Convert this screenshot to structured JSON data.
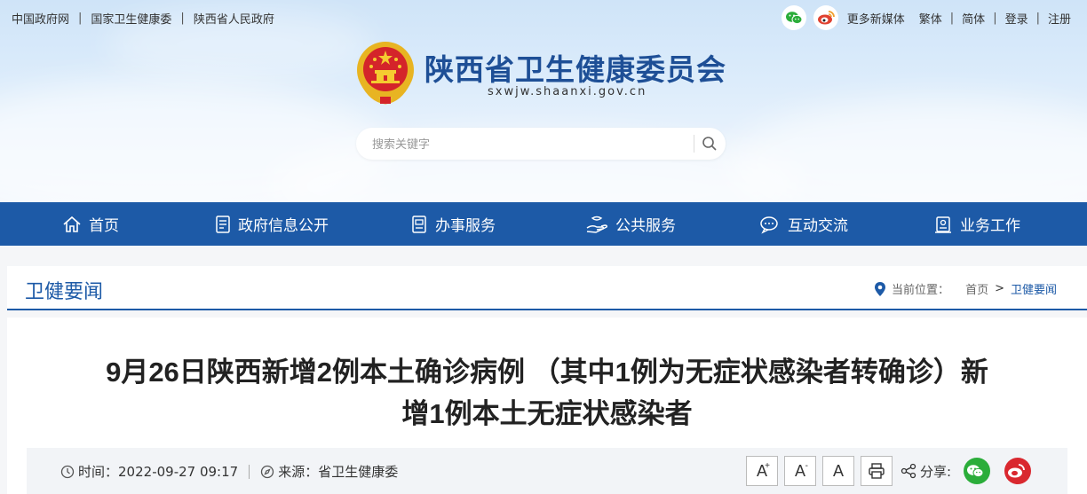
{
  "topbar": {
    "links": [
      "中国政府网",
      "国家卫生健康委",
      "陕西省人民政府"
    ],
    "more_media": "更多新媒体",
    "traditional": "繁体",
    "simplified": "简体",
    "login": "登录",
    "register": "注册"
  },
  "site": {
    "title": "陕西省卫生健康委员会",
    "domain": "sxwjw.shaanxi.gov.cn"
  },
  "search": {
    "placeholder": "搜索关键字"
  },
  "nav": {
    "items": [
      {
        "label": "首页",
        "icon": "home-icon"
      },
      {
        "label": "政府信息公开",
        "icon": "document-icon"
      },
      {
        "label": "办事服务",
        "icon": "file-list-icon"
      },
      {
        "label": "公共服务",
        "icon": "hand-service-icon"
      },
      {
        "label": "互动交流",
        "icon": "chat-icon"
      },
      {
        "label": "业务工作",
        "icon": "briefcase-icon"
      }
    ]
  },
  "breadcrumb": {
    "section": "卫健要闻",
    "location_label": "当前位置：",
    "home": "首页",
    "separator": ">",
    "current": "卫健要闻"
  },
  "article": {
    "title_line1": "9月26日陕西新增2例本土确诊病例 （其中1例为无症状感染者转确诊）新",
    "title_line2": "增1例本土无症状感染者",
    "time_label": "时间：",
    "time_value": "2022-09-27 09:17",
    "source_label": "来源：",
    "source_value": "省卫生健康委",
    "font_larger": "A",
    "font_smaller": "A",
    "font_normal": "A",
    "share_label": "分享:"
  },
  "colors": {
    "brand_blue": "#1d5aa7",
    "title_blue": "#1e4f96",
    "wechat_green": "#2bad3a",
    "weibo_red": "#d9282f"
  }
}
